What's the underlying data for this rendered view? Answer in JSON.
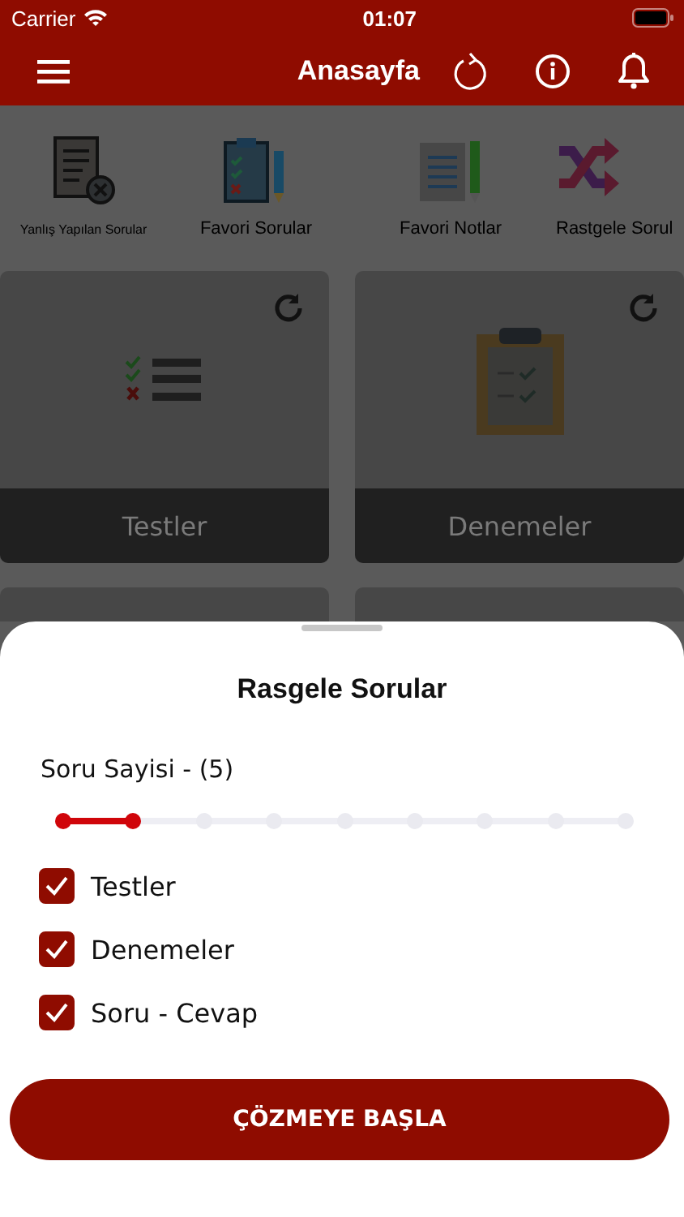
{
  "status_bar": {
    "carrier": "Carrier",
    "time": "01:07"
  },
  "header": {
    "title": "Anasayfa"
  },
  "shortcuts": [
    {
      "label": "Yanlış Yapılan Sorular",
      "kind": "wrong"
    },
    {
      "label": "Favori Sorular",
      "kind": "clipboard"
    },
    {
      "label": "Favori Notlar",
      "kind": "notes"
    },
    {
      "label": "Rastgele Sorul",
      "kind": "shuffle"
    }
  ],
  "cards": [
    {
      "label": "Testler",
      "kind": "list"
    },
    {
      "label": "Denemeler",
      "kind": "clipboard"
    }
  ],
  "sheet": {
    "title": "Rasgele Sorular",
    "slider_label": "Soru Sayisi - (5)",
    "slider": {
      "level": 0.125
    },
    "options": [
      {
        "label": "Testler",
        "checked": true
      },
      {
        "label": "Denemeler",
        "checked": true
      },
      {
        "label": "Soru - Cevap",
        "checked": true
      }
    ],
    "button": "ÇÖZMEYE BAŞLA"
  }
}
